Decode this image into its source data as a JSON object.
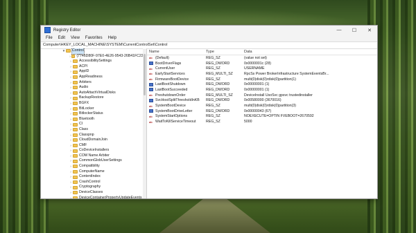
{
  "window": {
    "title": "Registry Editor",
    "controls": [
      "—",
      "☐",
      "✕"
    ]
  },
  "menu": [
    "File",
    "Edit",
    "View",
    "Favorites",
    "Help"
  ],
  "address": "Computer\\HKEY_LOCAL_MACHINE\\SYSTEM\\CurrentControlSet\\Control",
  "tree": {
    "selected": "Control",
    "items": [
      "{7746D80F-97E0-4E26-9543-26B41FC22...",
      "AccessibilitySettings",
      "ACPI",
      "AppID",
      "AppReadiness",
      "Arbiters",
      "Audio",
      "AutoAttachVirtualDisks",
      "BackupRestore",
      "BGFX",
      "BitLocker",
      "BitlockerStatus",
      "Bluetooth",
      "CI",
      "Class",
      "Classpnp",
      "CloudDomainJoin",
      "CMF",
      "CoDeviceInstallers",
      "COM Name Arbiter",
      "CommonGlobUserSettings",
      "Compatibility",
      "ComputerName",
      "ContentIndex",
      "CrashControl",
      "Cryptography",
      "DeviceClasses",
      "DeviceContainerPropertyUpdateEvents"
    ]
  },
  "values": {
    "headers": {
      "name": "Name",
      "type": "Type",
      "data": "Data"
    },
    "rows": [
      {
        "icon": "ab",
        "name": "(Default)",
        "type": "REG_SZ",
        "data": "(value not set)"
      },
      {
        "icon": "bin",
        "name": "BootDriverFlags",
        "type": "REG_DWORD",
        "data": "0x0000001c (28)"
      },
      {
        "icon": "ab",
        "name": "CurrentUser",
        "type": "REG_SZ",
        "data": "USERNAME"
      },
      {
        "icon": "ab",
        "name": "EarlyStartServices",
        "type": "REG_MULTI_SZ",
        "data": "RpcSs Power BrokerInfrastructure SystemEventsBr..."
      },
      {
        "icon": "ab",
        "name": "FirmwareBootDevice",
        "type": "REG_SZ",
        "data": "multi(0)disk(0)rdisk(0)partition(1)"
      },
      {
        "icon": "bin",
        "name": "LastBootShutdown",
        "type": "REG_DWORD",
        "data": "0x00000001 (1)"
      },
      {
        "icon": "bin",
        "name": "LastBootSucceeded",
        "type": "REG_DWORD",
        "data": "0x00000001 (1)"
      },
      {
        "icon": "ab",
        "name": "PreshutdownOrder",
        "type": "REG_MULTI_SZ",
        "data": "DeviceInstall UsoSvc gpsvc trustedinstaller"
      },
      {
        "icon": "bin",
        "name": "SvcHostSplitThresholdInKB",
        "type": "REG_DWORD",
        "data": "0x00580000 (3670016)"
      },
      {
        "icon": "ab",
        "name": "SystemBootDevice",
        "type": "REG_SZ",
        "data": "multi(0)disk(0)rdisk(0)partition(3)"
      },
      {
        "icon": "bin",
        "name": "SystemBootDriveLetter",
        "type": "REG_DWORD",
        "data": "0x00000043 (67)"
      },
      {
        "icon": "ab",
        "name": "SystemStartOptions",
        "type": "REG_SZ",
        "data": "NOEXECUTE=OPTIN FVEBOOT=2670592"
      },
      {
        "icon": "ab",
        "name": "WaitToKillServiceTimeout",
        "type": "REG_SZ",
        "data": "5000"
      }
    ]
  }
}
